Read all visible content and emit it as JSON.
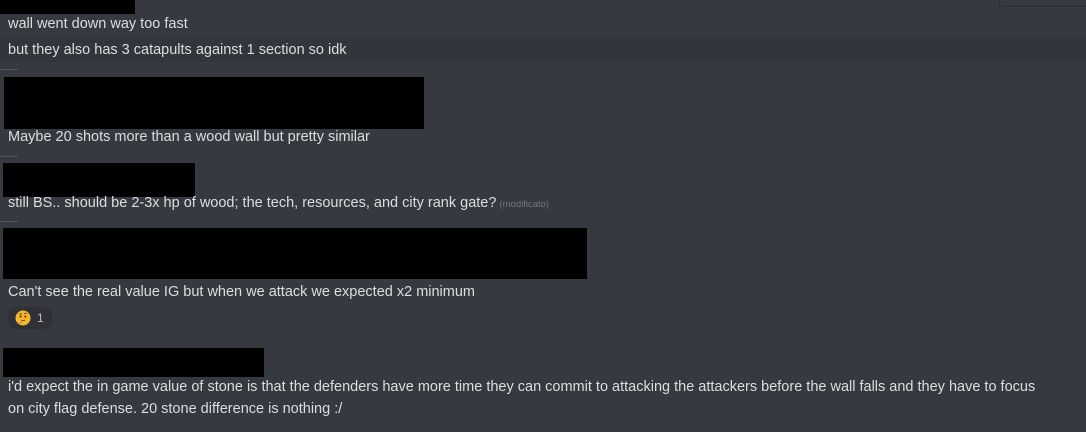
{
  "messages": [
    {
      "text": "wall went down way too fast"
    },
    {
      "text": "but they also has 3 catapults against 1 section so idk"
    },
    {
      "text": "Maybe 20 shots more than a wood wall but pretty similar"
    },
    {
      "text": "still BS.. should be 2-3x hp of wood; the tech, resources, and city rank gate?",
      "edited_label": "(modificato)"
    },
    {
      "text": "Can't see the real value IG but when we attack we expected x2 minimum"
    },
    {
      "text": "i'd expect the in game value of stone is that the defenders have more time they can commit to attacking the attackers before the wall falls and they have to focus on city flag defense. 20 stone difference is nothing :/"
    }
  ],
  "reaction": {
    "emoji": "thinking-face-icon",
    "count": "1"
  }
}
